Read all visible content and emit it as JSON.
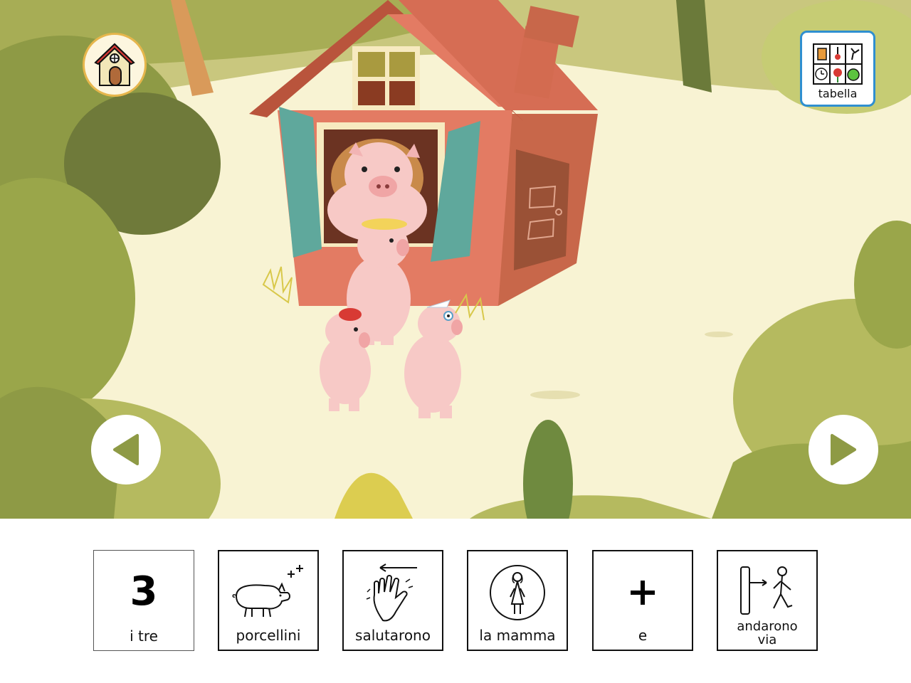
{
  "app": {
    "home_icon": "house-icon",
    "board_button": {
      "label": "tabella",
      "icon": "communication-board-icon"
    },
    "prev_icon": "arrow-left-icon",
    "next_icon": "arrow-right-icon"
  },
  "scene": {
    "icon": "three-little-pigs-illustration",
    "colors": {
      "background": "#f8f3d3",
      "house": "#e37b63",
      "foliage": "#9aa64a"
    }
  },
  "sentence": {
    "cards": [
      {
        "number": "3",
        "label": "i tre",
        "icon": "number-three-symbol"
      },
      {
        "label": "porcellini",
        "icon": "pigs-symbol"
      },
      {
        "label": "salutarono",
        "icon": "wave-hand-symbol"
      },
      {
        "label": "la mamma",
        "icon": "mother-symbol"
      },
      {
        "label": "e",
        "icon": "plus-symbol"
      },
      {
        "label": "andarono via",
        "label_line1": "andarono",
        "label_line2": "via",
        "icon": "walk-away-symbol"
      }
    ]
  }
}
